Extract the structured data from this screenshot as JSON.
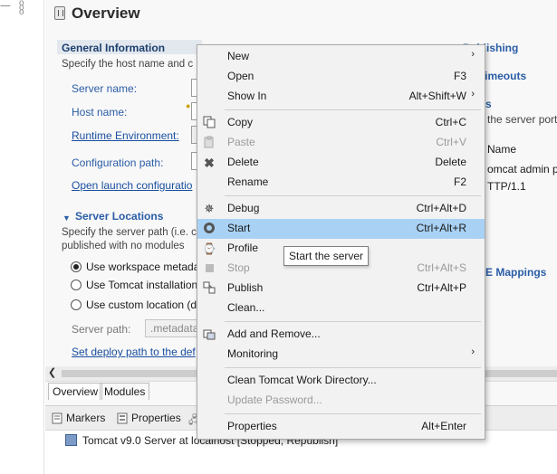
{
  "editor": {
    "title": "Overview",
    "general": {
      "heading": "General Information",
      "description": "Specify the host name and c",
      "fields": [
        {
          "label": "Server name:"
        },
        {
          "label": "Host name:"
        },
        {
          "label": "Runtime Environment:"
        },
        {
          "label": "Configuration path:"
        }
      ],
      "open_launch_link": "Open launch configuratio"
    },
    "locations": {
      "heading": "Server Locations",
      "description_line1": "Specify the server path (i.e. c",
      "description_line2": "published with no modules",
      "options": [
        {
          "label": "Use workspace metada",
          "selected": true
        },
        {
          "label": "Use Tomcat installation",
          "selected": false
        },
        {
          "label": "Use custom location (d",
          "selected": false
        }
      ],
      "server_path_label": "Server path:",
      "server_path_value": ".metadata",
      "deploy_link": "Set deploy path to the def"
    },
    "right_pane": {
      "publishing": "Publishing",
      "timeouts": "Timeouts",
      "ports_frag": "s",
      "ports_desc": "the server ports",
      "name_col": "Name",
      "row1": "omcat admin p",
      "row2": "TTP/1.1",
      "mime": "E Mappings"
    },
    "bottom_tabs": [
      "Overview",
      "Modules"
    ]
  },
  "views": {
    "tabs": [
      "Markers",
      "Properties"
    ],
    "server_entry": "Tomcat v9.0 Server at localhost  [Stopped, Republish]"
  },
  "menu": {
    "items": [
      {
        "label": "New",
        "shortcut": "",
        "submenu": true,
        "icon": ""
      },
      {
        "label": "Open",
        "shortcut": "F3",
        "icon": ""
      },
      {
        "label": "Show In",
        "shortcut": "Alt+Shift+W",
        "submenu": true,
        "icon": ""
      },
      {
        "label": "Copy",
        "shortcut": "Ctrl+C",
        "icon": "copy-icon"
      },
      {
        "label": "Paste",
        "shortcut": "Ctrl+V",
        "icon": "paste-icon",
        "disabled": true
      },
      {
        "label": "Delete",
        "shortcut": "Delete",
        "icon": "delete-icon"
      },
      {
        "label": "Rename",
        "shortcut": "F2",
        "icon": ""
      },
      {
        "label": "Debug",
        "shortcut": "Ctrl+Alt+D",
        "icon": "debug-icon"
      },
      {
        "label": "Start",
        "shortcut": "Ctrl+Alt+R",
        "icon": "start-icon",
        "highlighted": true
      },
      {
        "label": "Profile",
        "shortcut": "",
        "icon": "profile-icon"
      },
      {
        "label": "Stop",
        "shortcut": "Ctrl+Alt+S",
        "icon": "stop-icon",
        "disabled": true
      },
      {
        "label": "Publish",
        "shortcut": "Ctrl+Alt+P",
        "icon": "publish-icon"
      },
      {
        "label": "Clean...",
        "shortcut": "",
        "icon": ""
      },
      {
        "label": "Add and Remove...",
        "shortcut": "",
        "icon": "add-remove-icon"
      },
      {
        "label": "Monitoring",
        "shortcut": "",
        "submenu": true,
        "icon": ""
      },
      {
        "label": "Clean Tomcat Work Directory...",
        "shortcut": "",
        "icon": ""
      },
      {
        "label": "Update Password...",
        "shortcut": "",
        "icon": "",
        "disabled": true
      },
      {
        "label": "Properties",
        "shortcut": "Alt+Enter",
        "icon": ""
      }
    ],
    "tooltip": "Start the server"
  }
}
